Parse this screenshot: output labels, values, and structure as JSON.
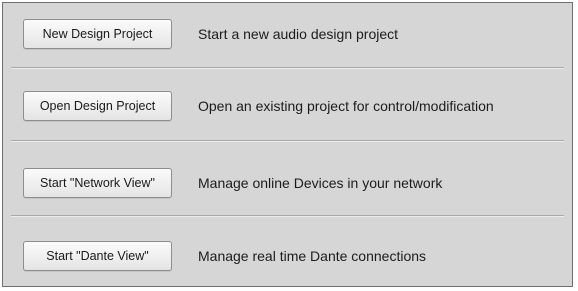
{
  "options": [
    {
      "button_label": "New Design Project",
      "description": "Start a new audio design project"
    },
    {
      "button_label": "Open Design Project",
      "description": "Open an existing project for control/modification"
    },
    {
      "button_label": "Start \"Network View\"",
      "description": "Manage online Devices in your network"
    },
    {
      "button_label": "Start \"Dante View\"",
      "description": "Manage real time Dante connections"
    }
  ],
  "colors": {
    "panel_background": "#d6d6d6",
    "panel_border": "#6f6f6f",
    "divider": "#a9a9a9"
  }
}
